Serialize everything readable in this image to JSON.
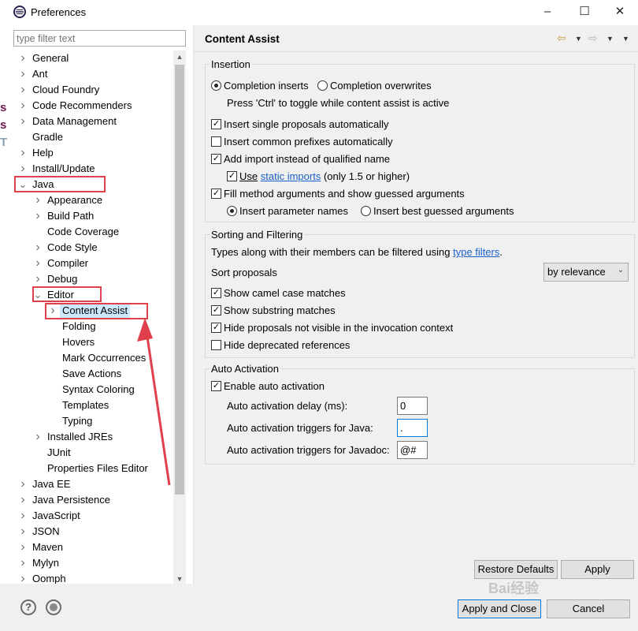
{
  "window": {
    "title": "Preferences",
    "icon": "eclipse-icon",
    "buttons": [
      "minimize",
      "maximize",
      "close"
    ]
  },
  "filter": {
    "placeholder": "type filter text"
  },
  "tree": {
    "items": [
      {
        "label": "General",
        "level": 0,
        "expander": "collapsed"
      },
      {
        "label": "Ant",
        "level": 0,
        "expander": "collapsed"
      },
      {
        "label": "Cloud Foundry",
        "level": 0,
        "expander": "collapsed"
      },
      {
        "label": "Code Recommenders",
        "level": 0,
        "expander": "collapsed"
      },
      {
        "label": "Data Management",
        "level": 0,
        "expander": "collapsed"
      },
      {
        "label": "Gradle",
        "level": 0,
        "expander": "none"
      },
      {
        "label": "Help",
        "level": 0,
        "expander": "collapsed"
      },
      {
        "label": "Install/Update",
        "level": 0,
        "expander": "collapsed"
      },
      {
        "label": "Java",
        "level": 0,
        "expander": "expanded"
      },
      {
        "label": "Appearance",
        "level": 1,
        "expander": "collapsed"
      },
      {
        "label": "Build Path",
        "level": 1,
        "expander": "collapsed"
      },
      {
        "label": "Code Coverage",
        "level": 1,
        "expander": "none"
      },
      {
        "label": "Code Style",
        "level": 1,
        "expander": "collapsed"
      },
      {
        "label": "Compiler",
        "level": 1,
        "expander": "collapsed"
      },
      {
        "label": "Debug",
        "level": 1,
        "expander": "collapsed"
      },
      {
        "label": "Editor",
        "level": 1,
        "expander": "expanded"
      },
      {
        "label": "Content Assist",
        "level": 2,
        "expander": "collapsed",
        "selected": true
      },
      {
        "label": "Folding",
        "level": 2,
        "expander": "none"
      },
      {
        "label": "Hovers",
        "level": 2,
        "expander": "none"
      },
      {
        "label": "Mark Occurrences",
        "level": 2,
        "expander": "none"
      },
      {
        "label": "Save Actions",
        "level": 2,
        "expander": "none"
      },
      {
        "label": "Syntax Coloring",
        "level": 2,
        "expander": "none"
      },
      {
        "label": "Templates",
        "level": 2,
        "expander": "none"
      },
      {
        "label": "Typing",
        "level": 2,
        "expander": "none"
      },
      {
        "label": "Installed JREs",
        "level": 1,
        "expander": "collapsed"
      },
      {
        "label": "JUnit",
        "level": 1,
        "expander": "none"
      },
      {
        "label": "Properties Files Editor",
        "level": 1,
        "expander": "none"
      },
      {
        "label": "Java EE",
        "level": 0,
        "expander": "collapsed"
      },
      {
        "label": "Java Persistence",
        "level": 0,
        "expander": "collapsed"
      },
      {
        "label": "JavaScript",
        "level": 0,
        "expander": "collapsed"
      },
      {
        "label": "JSON",
        "level": 0,
        "expander": "collapsed"
      },
      {
        "label": "Maven",
        "level": 0,
        "expander": "collapsed"
      },
      {
        "label": "Mylyn",
        "level": 0,
        "expander": "collapsed"
      },
      {
        "label": "Oomph",
        "level": 0,
        "expander": "collapsed"
      }
    ]
  },
  "page": {
    "title": "Content Assist",
    "nav": [
      "back-icon",
      "dropdown-icon",
      "forward-icon",
      "dropdown-icon",
      "menu-icon"
    ]
  },
  "insertion": {
    "title": "Insertion",
    "radio_inserts": "Completion inserts",
    "radio_overwrites": "Completion overwrites",
    "hint": "Press 'Ctrl' to toggle while content assist is active",
    "single_proposals": "Insert single proposals automatically",
    "common_prefixes": "Insert common prefixes automatically",
    "add_import": "Add import instead of qualified name",
    "use_prefix": "Use",
    "static_imports": "static imports",
    "use_suffix": "(only 1.5 or higher)",
    "fill_args": "Fill method arguments and show guessed arguments",
    "insert_param_names": "Insert parameter names",
    "insert_best_guessed": "Insert best guessed arguments"
  },
  "sorting": {
    "title": "Sorting and Filtering",
    "desc_prefix": "Types along with their members can be filtered using",
    "type_filters": "type filters",
    "desc_suffix": ".",
    "sort_label": "Sort proposals",
    "sort_value": "by relevance",
    "camel_case": "Show camel case matches",
    "substring": "Show substring matches",
    "hide_not_visible": "Hide proposals not visible in the invocation context",
    "hide_deprecated": "Hide deprecated references"
  },
  "auto": {
    "title": "Auto Activation",
    "enable": "Enable auto activation",
    "delay_label": "Auto activation delay (ms):",
    "delay_value": "0",
    "java_label": "Auto activation triggers for Java:",
    "java_value": ".",
    "javadoc_label": "Auto activation triggers for Javadoc:",
    "javadoc_value": "@#"
  },
  "buttons": {
    "restore": "Restore Defaults",
    "apply": "Apply",
    "apply_close": "Apply and Close",
    "cancel": "Cancel"
  },
  "bottom": {
    "help": "?"
  },
  "watermark": "Bai经验",
  "left_cut": [
    "s",
    "s",
    "T"
  ],
  "colors": {
    "annotation": "#e0404b",
    "link": "#1a5ec8",
    "selection": "#cce8ff"
  }
}
